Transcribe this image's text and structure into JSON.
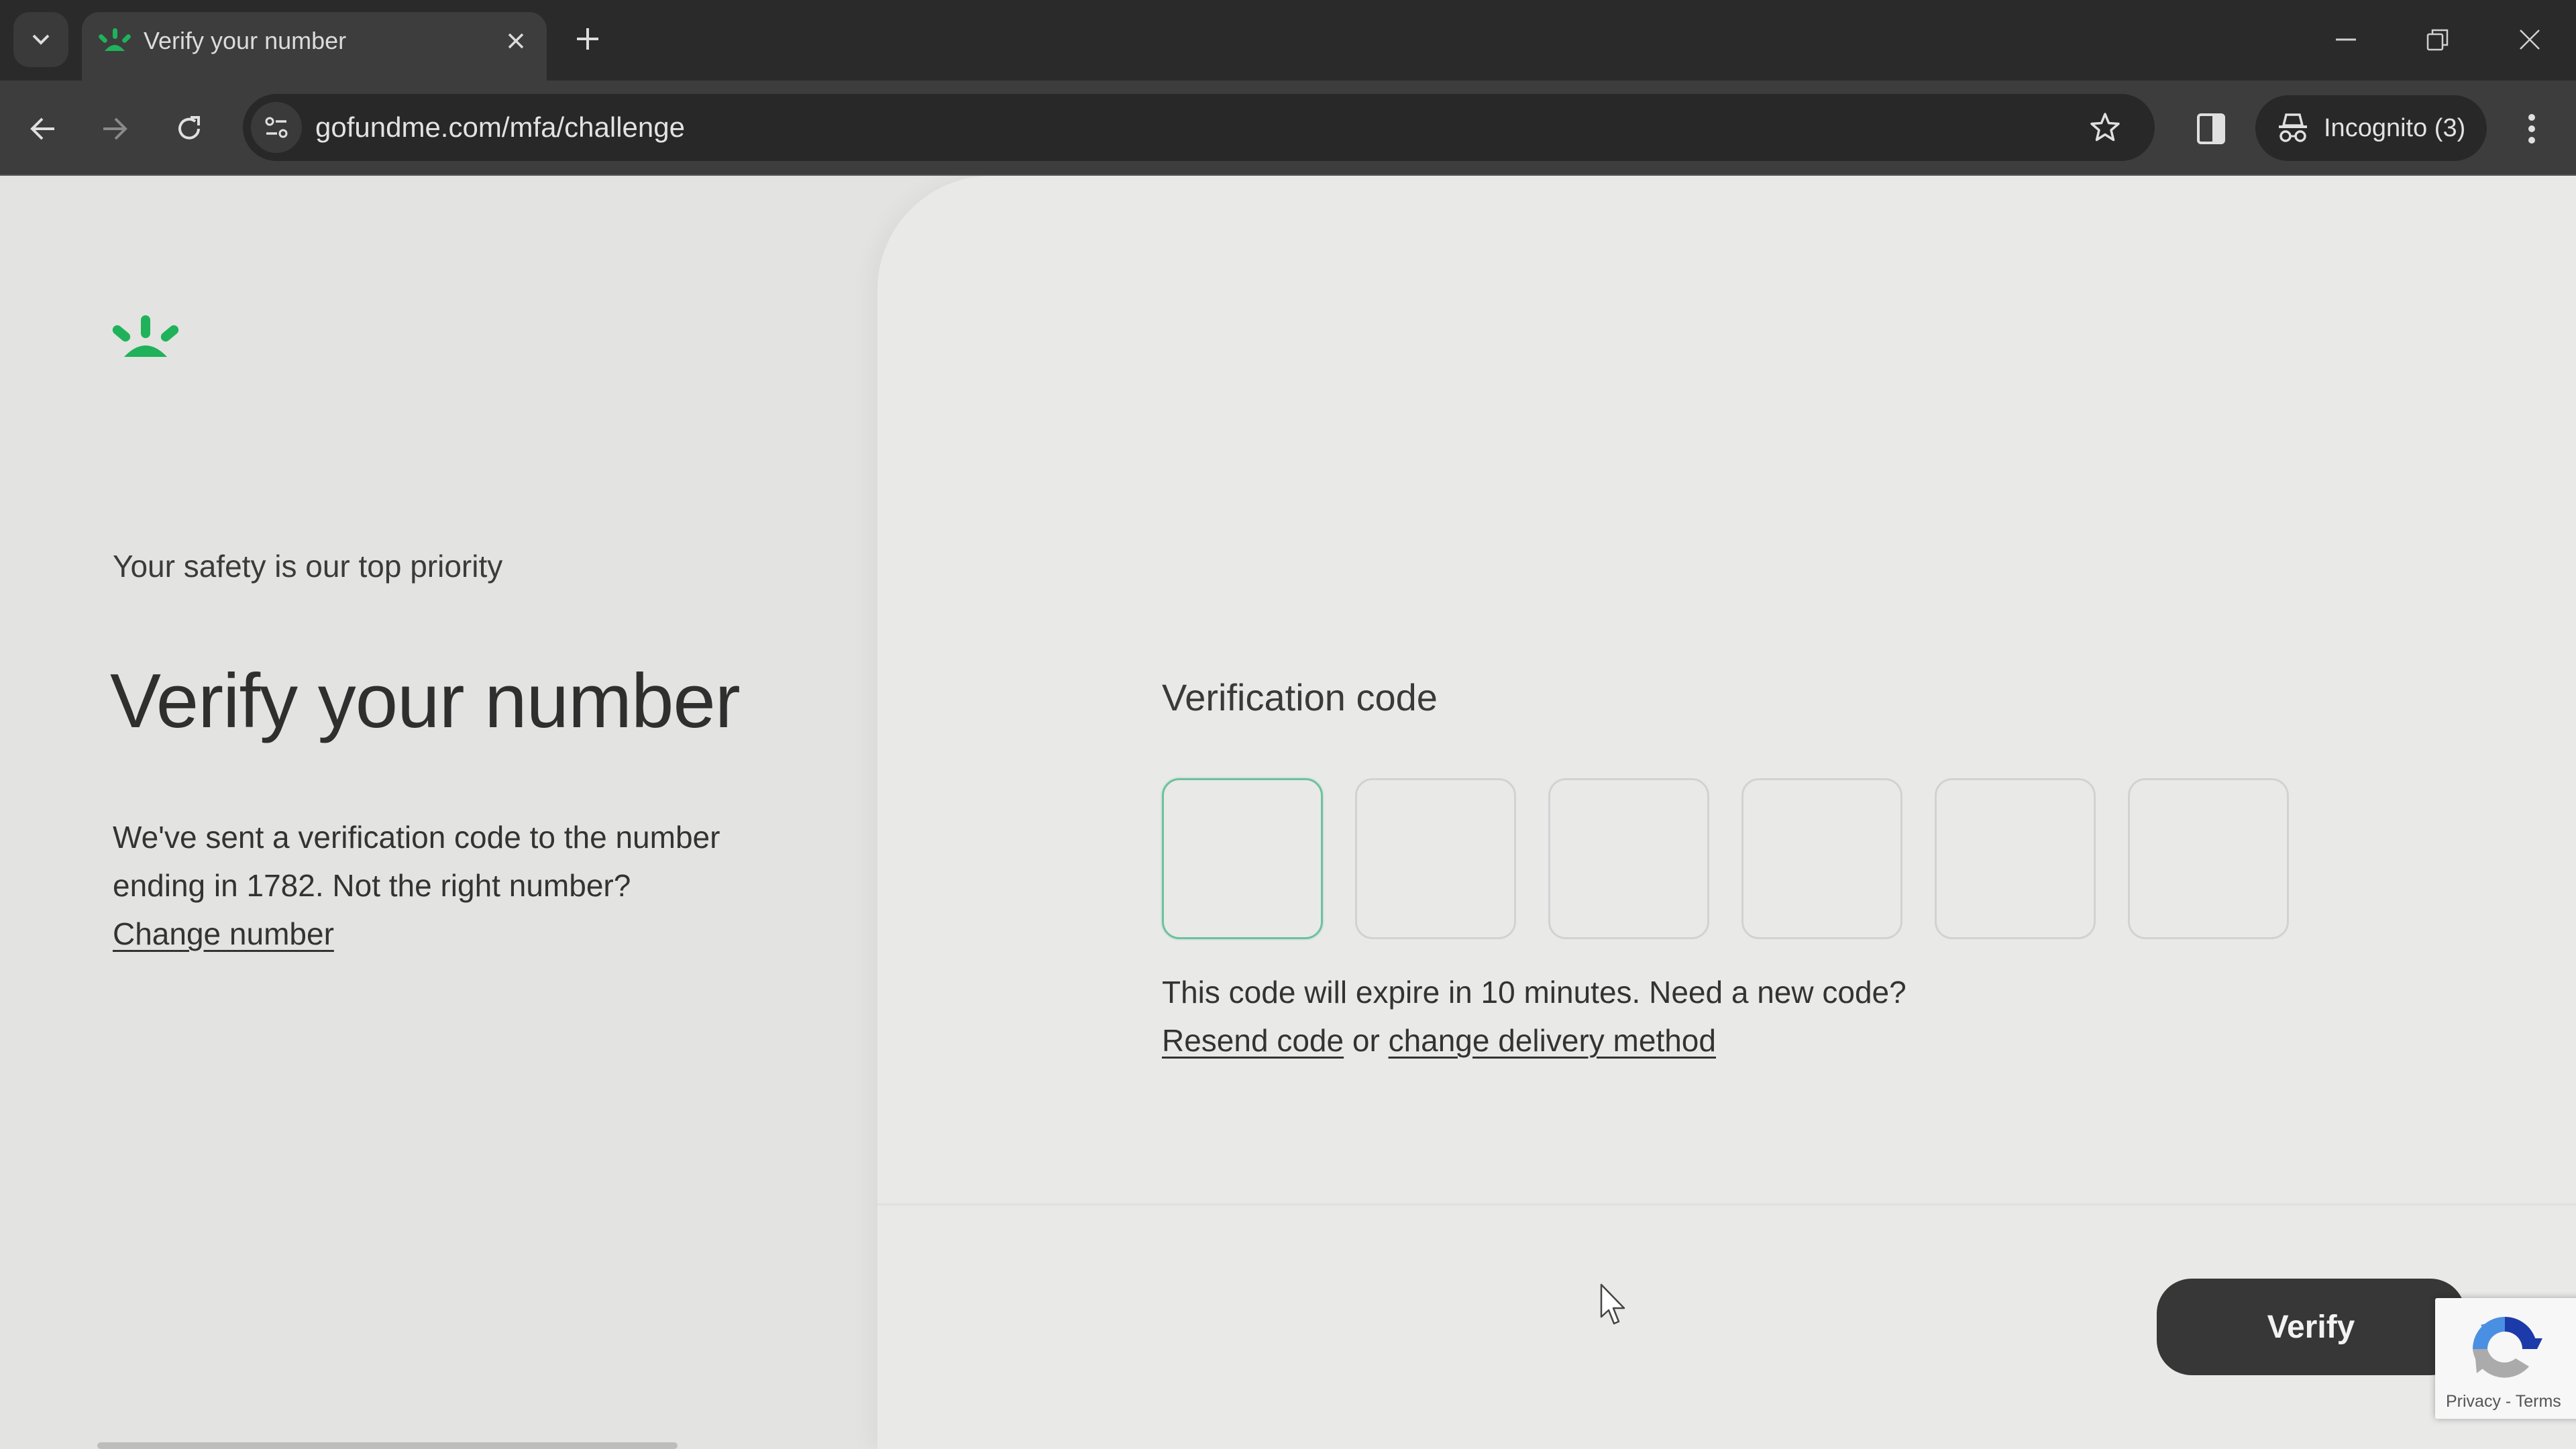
{
  "browser": {
    "tab": {
      "title": "Verify your number",
      "favicon": "gofundme-logo-icon"
    },
    "new_tab_label": "+",
    "tab_close_label": "×",
    "url": "gofundme.com/mfa/challenge",
    "incognito_label": "Incognito (3)",
    "icons": [
      "tab-search-icon",
      "back-icon",
      "forward-icon",
      "reload-icon",
      "site-info-icon",
      "bookmark-star-icon",
      "side-panel-icon",
      "incognito-icon",
      "more-menu-icon",
      "minimize-icon",
      "restore-icon",
      "close-window-icon"
    ]
  },
  "left": {
    "brand_color": "#1fb25a",
    "eyebrow": "Your safety is our top priority",
    "title": "Verify your number",
    "description": "We've sent a verification code to the number ending in 1782. Not the right number?",
    "change_number_link": "Change number"
  },
  "form": {
    "label": "Verification code",
    "digits": [
      "",
      "",
      "",
      "",
      "",
      ""
    ],
    "active_index": 0,
    "expiry_text": "This code will expire in 10 minutes. Need a new code?",
    "resend_link": "Resend code",
    "or_text": " or ",
    "change_method_link": "change delivery method",
    "submit_label": "Verify"
  },
  "recaptcha": {
    "privacy": "Privacy",
    "separator": " - ",
    "terms": "Terms"
  }
}
